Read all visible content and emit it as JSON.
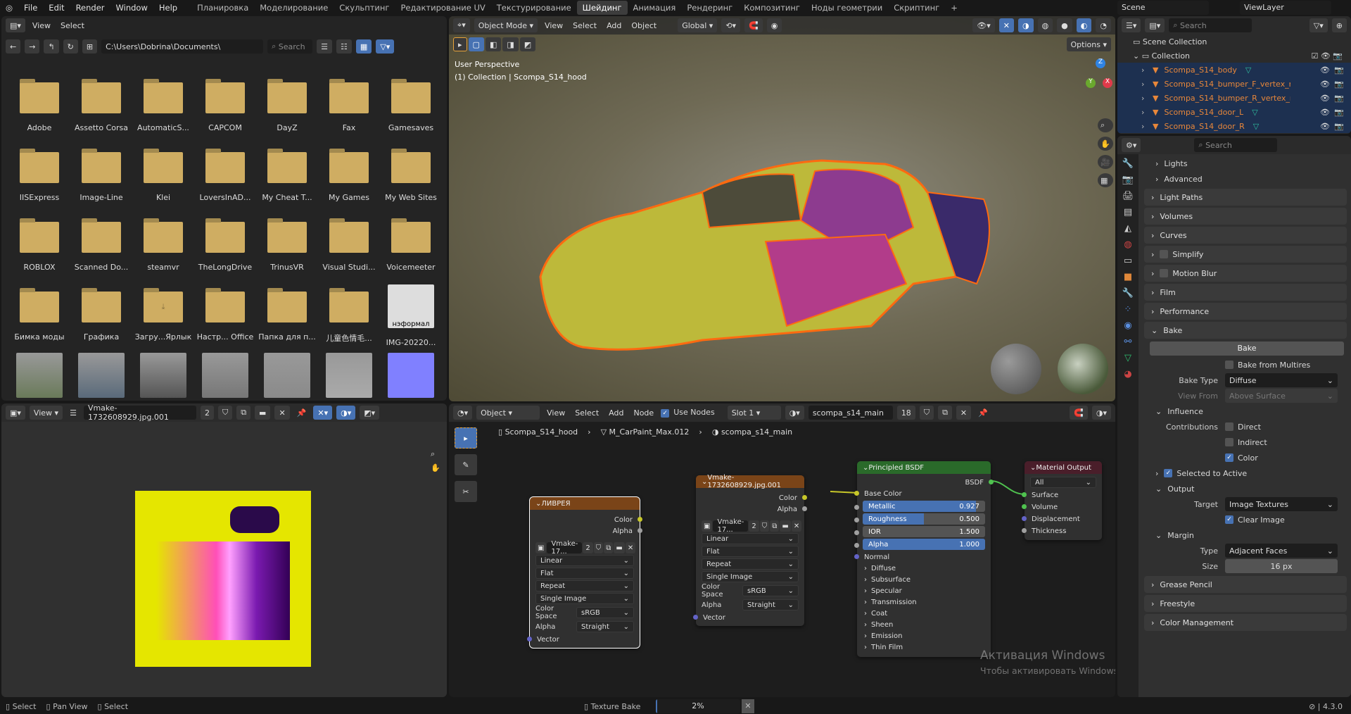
{
  "topbar": {
    "menus": [
      "File",
      "Edit",
      "Render",
      "Window",
      "Help"
    ],
    "workspaces": [
      "Планировка",
      "Моделирование",
      "Скульптинг",
      "Редактирование UV",
      "Текстурирование",
      "Шейдинг",
      "Анимация",
      "Рендеринг",
      "Композитинг",
      "Ноды геометрии",
      "Скриптинг"
    ],
    "active_workspace": "Шейдинг",
    "add": "+",
    "scene": "Scene",
    "view_layer": "ViewLayer"
  },
  "file_browser": {
    "menus": [
      "View",
      "Select"
    ],
    "path": "C:\\Users\\Dobrina\\Documents\\",
    "search_placeholder": "Search",
    "items": [
      {
        "name": "Adobe",
        "type": "folder"
      },
      {
        "name": "Assetto Corsa",
        "type": "folder"
      },
      {
        "name": "AutomaticS...",
        "type": "folder"
      },
      {
        "name": "CAPCOM",
        "type": "folder"
      },
      {
        "name": "DayZ",
        "type": "folder"
      },
      {
        "name": "Fax",
        "type": "folder"
      },
      {
        "name": "Gamesaves",
        "type": "folder"
      },
      {
        "name": "IISExpress",
        "type": "folder"
      },
      {
        "name": "Image-Line",
        "type": "folder"
      },
      {
        "name": "Klei",
        "type": "folder"
      },
      {
        "name": "LoversInAD...",
        "type": "folder"
      },
      {
        "name": "My Cheat T...",
        "type": "folder"
      },
      {
        "name": "My Games",
        "type": "folder"
      },
      {
        "name": "My Web Sites",
        "type": "folder"
      },
      {
        "name": "ROBLOX",
        "type": "folder"
      },
      {
        "name": "Scanned Do...",
        "type": "folder"
      },
      {
        "name": "steamvr",
        "type": "folder"
      },
      {
        "name": "TheLongDrive",
        "type": "folder"
      },
      {
        "name": "TrinusVR",
        "type": "folder"
      },
      {
        "name": "Visual Studi...",
        "type": "folder"
      },
      {
        "name": "Voicemeeter",
        "type": "folder"
      },
      {
        "name": "Бимка моды",
        "type": "folder"
      },
      {
        "name": "Графика",
        "type": "folder"
      },
      {
        "name": "Загру...Ярлык",
        "type": "shortcut"
      },
      {
        "name": "Настр... Office",
        "type": "folder"
      },
      {
        "name": "Папка для п...",
        "type": "folder"
      },
      {
        "name": "儿童色情毛...",
        "type": "folder"
      },
      {
        "name": "IMG-20220...",
        "type": "image",
        "caption": "нэформал"
      },
      {
        "name": "",
        "type": "image"
      },
      {
        "name": "",
        "type": "image"
      },
      {
        "name": "",
        "type": "image"
      },
      {
        "name": "",
        "type": "image"
      },
      {
        "name": "",
        "type": "image"
      },
      {
        "name": "",
        "type": "image"
      },
      {
        "name": "",
        "type": "image-blue"
      }
    ]
  },
  "viewport": {
    "mode": "Object Mode",
    "menus": [
      "View",
      "Select",
      "Add",
      "Object"
    ],
    "orientation": "Global",
    "options": "Options",
    "perspective": "User Perspective",
    "collection_info": "(1) Collection | Scompa_S14_hood",
    "gizmo": {
      "z": "Z",
      "y": "Y",
      "x": "X"
    }
  },
  "outliner": {
    "search_placeholder": "Search",
    "scene_collection": "Scene Collection",
    "collection": "Collection",
    "objects": [
      {
        "name": "Scompa_S14_body",
        "modifier": true
      },
      {
        "name": "Scompa_S14_bumper_F_vertex_ri",
        "modifier": false
      },
      {
        "name": "Scompa_S14_bumper_R_vertex_ri",
        "modifier": false
      },
      {
        "name": "Scompa_S14_door_L",
        "modifier": true
      },
      {
        "name": "Scompa_S14_door_R",
        "modifier": true
      }
    ]
  },
  "image_editor": {
    "view": "View",
    "image_name": "Vmake-1732608929.jpg.001",
    "users": "2"
  },
  "node_editor": {
    "object": "Object",
    "menus": [
      "View",
      "Select",
      "Add",
      "Node"
    ],
    "use_nodes": "Use Nodes",
    "slot": "Slot 1",
    "material": "scompa_s14_main",
    "material_users": "18",
    "breadcrumb": [
      "Scompa_S14_hood",
      "M_CarPaint_Max.012",
      "scompa_s14_main"
    ],
    "nodes": {
      "livery": {
        "title": "ЛИВРЕЯ",
        "out_color": "Color",
        "out_alpha": "Alpha",
        "image": "Vmake-17...",
        "users": "2",
        "interp": "Linear",
        "proj": "Flat",
        "ext": "Repeat",
        "source": "Single Image",
        "cs_label": "Color Space",
        "cs": "sRGB",
        "alpha_label": "Alpha",
        "alpha": "Straight",
        "vector": "Vector"
      },
      "vmake": {
        "title": "Vmake-1732608929.jpg.001",
        "out_color": "Color",
        "out_alpha": "Alpha",
        "image": "Vmake-17...",
        "users": "2",
        "interp": "Linear",
        "proj": "Flat",
        "ext": "Repeat",
        "source": "Single Image",
        "cs_label": "Color Space",
        "cs": "sRGB",
        "alpha_label": "Alpha",
        "alpha": "Straight",
        "vector": "Vector"
      },
      "bsdf": {
        "title": "Principled BSDF",
        "out": "BSDF",
        "base_color": "Base Color",
        "metallic_label": "Metallic",
        "metallic": 0.927,
        "metallic_text": "0.927",
        "roughness_label": "Roughness",
        "roughness": 0.5,
        "roughness_text": "0.500",
        "ior_label": "IOR",
        "ior_text": "1.500",
        "alpha_label": "Alpha",
        "alpha": 1.0,
        "alpha_text": "1.000",
        "normal": "Normal",
        "panels": [
          "Diffuse",
          "Subsurface",
          "Specular",
          "Transmission",
          "Coat",
          "Sheen",
          "Emission",
          "Thin Film"
        ]
      },
      "output": {
        "title": "Material Output",
        "target": "All",
        "inputs": [
          "Surface",
          "Volume",
          "Displacement",
          "Thickness"
        ]
      }
    }
  },
  "properties": {
    "search_placeholder": "Search",
    "sub": [
      "Lights",
      "Advanced"
    ],
    "panels_top": [
      "Light Paths",
      "Volumes",
      "Curves",
      "Simplify",
      "Motion Blur",
      "Film",
      "Performance"
    ],
    "bake": "Bake",
    "bake_button": "Bake",
    "bake_from_multires": "Bake from Multires",
    "bake_type_label": "Bake Type",
    "bake_type": "Diffuse",
    "view_from_label": "View From",
    "view_from": "Above Surface",
    "influence": "Influence",
    "contributions": "Contributions",
    "direct": "Direct",
    "indirect": "Indirect",
    "color": "Color",
    "selected_to_active": "Selected to Active",
    "output": "Output",
    "target_label": "Target",
    "target": "Image Textures",
    "clear_image": "Clear Image",
    "margin": "Margin",
    "type_label": "Type",
    "type": "Adjacent Faces",
    "size_label": "Size",
    "size": "16 px",
    "panels_bottom": [
      "Grease Pencil",
      "Freestyle",
      "Color Management"
    ]
  },
  "watermark": {
    "title": "Активация Windows",
    "text": "Чтобы активировать Windows, перейдите в раздел \"Параметры\"."
  },
  "statusbar": {
    "hints": [
      "Select",
      "Pan View",
      "Select"
    ],
    "job": "Texture Bake",
    "progress_text": "2%",
    "progress": 0.02,
    "version": "4.3.0"
  }
}
